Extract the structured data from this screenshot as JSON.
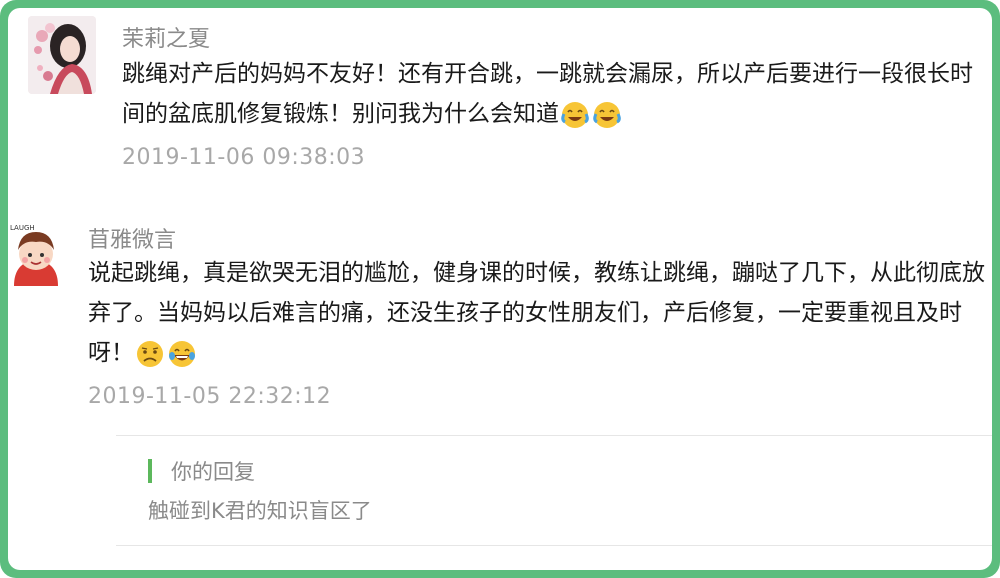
{
  "comments": [
    {
      "username": "茉莉之夏",
      "text": "跳绳对产后的妈妈不友好！还有开合跳，一跳就会漏尿，所以产后要进行一段很长时间的盆底肌修复锻炼！别问我为什么会知道",
      "emojis": [
        "crying-laughing-emoji",
        "crying-laughing-emoji"
      ],
      "timestamp": "2019-11-06 09:38:03"
    },
    {
      "username": "苜雅微言",
      "avatar_caption": "LAUGH",
      "text": "说起跳绳，真是欲哭无泪的尴尬，健身课的时候，教练让跳绳，蹦哒了几下，从此彻底放弃了。当妈妈以后难言的痛，还没生孩子的女性朋友们，产后修复，一定要重视且及时呀！",
      "emojis": [
        "sad-face-emoji",
        "tears-of-joy-emoji"
      ],
      "timestamp": "2019-11-05 22:32:12"
    }
  ],
  "reply": {
    "label": "你的回复",
    "text": "触碰到K君的知识盲区了"
  },
  "colors": {
    "frame": "#5cbd7e",
    "accent_bar": "#5cb85c",
    "meta_text": "#8a8a8a",
    "body_text": "#1a1a1a"
  }
}
